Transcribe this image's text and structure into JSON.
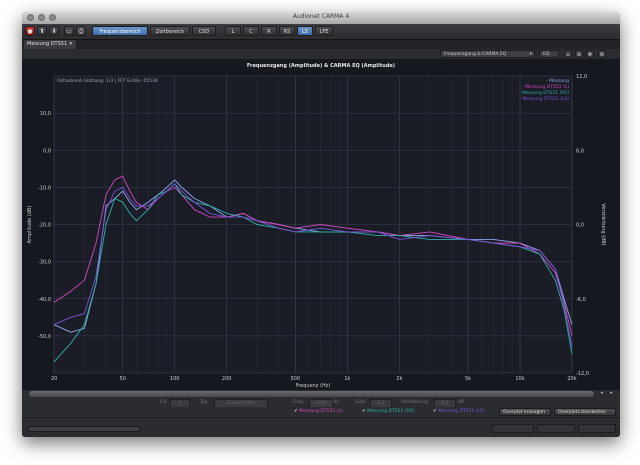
{
  "window": {
    "title": "Audionet CARMA 4"
  },
  "toolbar": {
    "tabs": [
      "Frequenzbereich",
      "Zeitbereich",
      "CSD"
    ],
    "channels": [
      "L",
      "C",
      "R",
      "RS",
      "LS",
      "LFE"
    ],
    "active_tab": "Frequenzbereich",
    "active_channel": "LS"
  },
  "doc_tab": {
    "label": "Messung DTS51",
    "close": "✕"
  },
  "controls": {
    "view_select": "Frequenzgang & CARMA EQ",
    "eq_select": "EQ"
  },
  "chart_data": {
    "type": "line",
    "title": "Frequenzgang (Amplitude) & CARMA EQ (Amplitude)",
    "xlabel": "Frequenz (Hz)",
    "ylabel": "Amplitude (dB)",
    "y2label": "Verstärkung (dB)",
    "info": "Oktavband-Glättung: 1/3 | FFT Größe: 65536",
    "xscale": "log",
    "xlim": [
      20,
      20000
    ],
    "ylim": [
      -60,
      20
    ],
    "y2lim": [
      -12,
      12
    ],
    "xticks": [
      20,
      50,
      100,
      200,
      500,
      1000,
      2000,
      5000,
      10000,
      20000
    ],
    "xtick_labels": [
      "20",
      "50",
      "100",
      "200",
      "500",
      "1k",
      "2k",
      "5k",
      "10k",
      "20k"
    ],
    "yticks": [
      10,
      0,
      -10,
      -20,
      -30,
      -40,
      -50
    ],
    "ytick_labels": [
      "10,0",
      "0,0",
      "-10,0",
      "-20,0",
      "-30,0",
      "-40,0",
      "-50,0"
    ],
    "y2ticks": [
      12,
      6,
      0,
      -6,
      -12
    ],
    "y2tick_labels": [
      "12,0",
      "6,0",
      "0,0",
      "-6,0",
      "-12,0"
    ],
    "grid": true,
    "legend_position": "top-right",
    "series": [
      {
        "name": "Messung",
        "color": "#8fa6ea",
        "x": [
          20,
          25,
          30,
          35,
          40,
          45,
          50,
          55,
          60,
          70,
          80,
          90,
          100,
          110,
          130,
          160,
          200,
          250,
          300,
          400,
          500,
          700,
          1000,
          1500,
          2000,
          3000,
          5000,
          7000,
          10000,
          13000,
          16000,
          18000,
          20000
        ],
        "y": [
          -47,
          -49,
          -48,
          -36,
          -15,
          -13,
          -11,
          -14,
          -16,
          -14,
          -12,
          -10,
          -8,
          -10,
          -13,
          -15,
          -18,
          -17,
          -19,
          -20,
          -21,
          -22,
          -22,
          -22,
          -23,
          -23,
          -24,
          -24,
          -25,
          -27,
          -32,
          -40,
          -47
        ]
      },
      {
        "name": "Messung DTS51 (L)",
        "color": "#d548c4",
        "x": [
          20,
          25,
          30,
          35,
          40,
          45,
          50,
          55,
          60,
          70,
          80,
          90,
          100,
          110,
          130,
          160,
          200,
          250,
          300,
          400,
          500,
          700,
          1000,
          1500,
          2000,
          3000,
          5000,
          7000,
          10000,
          13000,
          16000,
          18000,
          20000
        ],
        "y": [
          -41,
          -38,
          -35,
          -25,
          -12,
          -8,
          -7,
          -11,
          -14,
          -16,
          -13,
          -11,
          -10,
          -12,
          -16,
          -18,
          -18,
          -17,
          -19,
          -20,
          -21,
          -20,
          -21,
          -22,
          -23,
          -22,
          -24,
          -25,
          -25,
          -28,
          -33,
          -41,
          -50
        ]
      },
      {
        "name": "Messung DTS51 (RS)",
        "color": "#27b4a8",
        "x": [
          20,
          25,
          30,
          35,
          40,
          45,
          50,
          55,
          60,
          70,
          80,
          90,
          100,
          110,
          130,
          160,
          200,
          250,
          300,
          400,
          500,
          700,
          1000,
          1500,
          2000,
          3000,
          5000,
          7000,
          10000,
          13000,
          16000,
          18000,
          20000
        ],
        "y": [
          -57,
          -52,
          -47,
          -36,
          -20,
          -13,
          -14,
          -17,
          -19,
          -16,
          -12,
          -11,
          -9,
          -12,
          -14,
          -15,
          -17,
          -18,
          -20,
          -21,
          -22,
          -22,
          -22,
          -23,
          -23,
          -24,
          -24,
          -25,
          -26,
          -28,
          -35,
          -43,
          -55
        ]
      },
      {
        "name": "Messung DTS51 (LS)",
        "color": "#7a52d8",
        "x": [
          20,
          25,
          30,
          35,
          40,
          45,
          50,
          55,
          60,
          70,
          80,
          90,
          100,
          110,
          130,
          160,
          200,
          250,
          300,
          400,
          500,
          700,
          1000,
          1500,
          2000,
          3000,
          5000,
          7000,
          10000,
          13000,
          16000,
          18000,
          20000
        ],
        "y": [
          -47,
          -45,
          -44,
          -34,
          -16,
          -11,
          -10,
          -13,
          -15,
          -15,
          -13,
          -11,
          -9,
          -11,
          -14,
          -17,
          -18,
          -18,
          -19,
          -21,
          -22,
          -21,
          -22,
          -22,
          -24,
          -23,
          -24,
          -25,
          -26,
          -27,
          -32,
          -42,
          -53
        ]
      }
    ]
  },
  "eq_row": {
    "eq_label": "EQ",
    "eq_value": "1",
    "typ_label": "Typ",
    "typ_value": "Glockenfilter",
    "freq_label": "Freq.",
    "freq_value": "1000",
    "freq_unit": "Hz",
    "guete_label": "Güte",
    "guete_value": "1,0",
    "gain_label": "Verstärkung",
    "gain_value": "0,0",
    "gain_unit": "dB"
  },
  "legend_row": {
    "items": [
      {
        "label": "Messung DTS51 (L)",
        "color": "#d548c4"
      },
      {
        "label": "Messung DTS51 (RS)",
        "color": "#27b4a8"
      },
      {
        "label": "Messung DTS51 (LS)",
        "color": "#7a52d8"
      }
    ],
    "overplot_create": "Overplot erzeugen",
    "overplot_edit": "Overplots bearbeiten"
  }
}
